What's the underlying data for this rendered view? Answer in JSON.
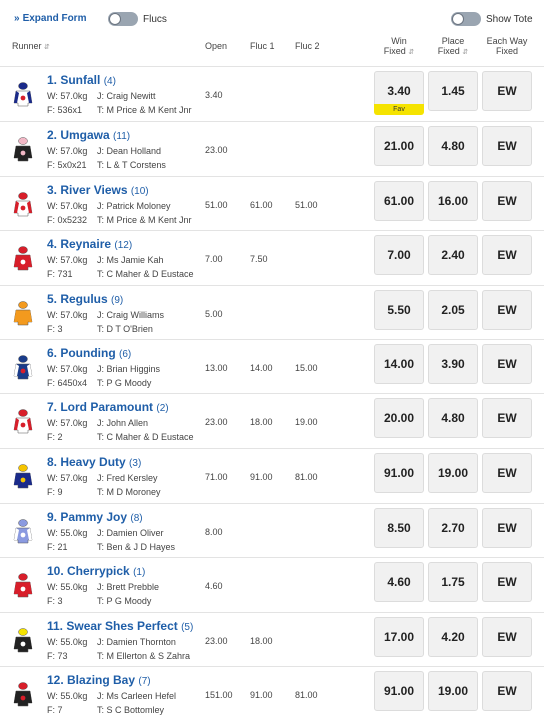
{
  "toolbar": {
    "expand_label": "Expand Form",
    "flucs_label": "Flucs",
    "show_tote_label": "Show Tote"
  },
  "columns": {
    "runner": "Runner",
    "open": "Open",
    "fluc1": "Fluc 1",
    "fluc2": "Fluc 2",
    "win_fixed_1": "Win",
    "win_fixed_2": "Fixed",
    "place_fixed_1": "Place",
    "place_fixed_2": "Fixed",
    "ew_1": "Each Way",
    "ew_2": "Fixed"
  },
  "fav_label": "Fav",
  "runners": [
    {
      "name": "1. Sunfall",
      "barrier": "(4)",
      "weight": "W: 57.0kg",
      "jockey": "J: Craig Newitt",
      "form": "F: 536x1",
      "trainer": "T: M Price & M Kent Jnr",
      "open": "3.40",
      "fluc1": "",
      "fluc2": "",
      "win": "3.40",
      "place": "1.45",
      "ew": "EW",
      "silk": {
        "body": "#ffffff",
        "sleeve": "#1a2a8a",
        "cap": "#1a2a8a",
        "accent": "#d81e2a"
      }
    },
    {
      "name": "2. Umgawa",
      "barrier": "(11)",
      "weight": "W: 57.0kg",
      "jockey": "J: Dean Holland",
      "form": "F: 5x0x21",
      "trainer": "T: L & T Corstens",
      "open": "23.00",
      "fluc1": "",
      "fluc2": "",
      "win": "21.00",
      "place": "4.80",
      "ew": "EW",
      "silk": {
        "body": "#222222",
        "sleeve": "#222222",
        "cap": "#f2b8c6",
        "accent": "#f2b8c6"
      }
    },
    {
      "name": "3. River Views",
      "barrier": "(10)",
      "weight": "W: 57.0kg",
      "jockey": "J: Patrick Moloney",
      "form": "F: 0x5232",
      "trainer": "T: M Price & M Kent Jnr",
      "open": "51.00",
      "fluc1": "61.00",
      "fluc2": "51.00",
      "win": "61.00",
      "place": "16.00",
      "ew": "EW",
      "silk": {
        "body": "#ffffff",
        "sleeve": "#d81e2a",
        "cap": "#d81e2a",
        "accent": "#d81e2a"
      }
    },
    {
      "name": "4. Reynaire",
      "barrier": "(12)",
      "weight": "W: 57.0kg",
      "jockey": "J: Ms Jamie Kah",
      "form": "F: 731",
      "trainer": "T: C Maher & D Eustace",
      "open": "7.00",
      "fluc1": "7.50",
      "fluc2": "",
      "win": "7.00",
      "place": "2.40",
      "ew": "EW",
      "silk": {
        "body": "#d81e2a",
        "sleeve": "#d81e2a",
        "cap": "#d81e2a",
        "accent": "#ffffff"
      }
    },
    {
      "name": "5. Regulus",
      "barrier": "(9)",
      "weight": "W: 57.0kg",
      "jockey": "J: Craig Williams",
      "form": "F: 3",
      "trainer": "T: D T O'Brien",
      "open": "5.00",
      "fluc1": "",
      "fluc2": "",
      "win": "5.50",
      "place": "2.05",
      "ew": "EW",
      "silk": {
        "body": "#f39a1e",
        "sleeve": "#f39a1e",
        "cap": "#f39a1e",
        "accent": "#f39a1e"
      }
    },
    {
      "name": "6. Pounding",
      "barrier": "(6)",
      "weight": "W: 57.0kg",
      "jockey": "J: Brian Higgins",
      "form": "F: 6450x4",
      "trainer": "T: P G Moody",
      "open": "13.00",
      "fluc1": "14.00",
      "fluc2": "15.00",
      "win": "14.00",
      "place": "3.90",
      "ew": "EW",
      "silk": {
        "body": "#1a3c8a",
        "sleeve": "#ffffff",
        "cap": "#1a3c8a",
        "accent": "#d81e2a"
      }
    },
    {
      "name": "7. Lord Paramount",
      "barrier": "(2)",
      "weight": "W: 57.0kg",
      "jockey": "J: John Allen",
      "form": "F: 2",
      "trainer": "T: C Maher & D Eustace",
      "open": "23.00",
      "fluc1": "18.00",
      "fluc2": "19.00",
      "win": "20.00",
      "place": "4.80",
      "ew": "EW",
      "silk": {
        "body": "#ffffff",
        "sleeve": "#d81e2a",
        "cap": "#d81e2a",
        "accent": "#d81e2a"
      }
    },
    {
      "name": "8. Heavy Duty",
      "barrier": "(3)",
      "weight": "W: 57.0kg",
      "jockey": "J: Fred Kersley",
      "form": "F: 9",
      "trainer": "T: M D Moroney",
      "open": "71.00",
      "fluc1": "91.00",
      "fluc2": "81.00",
      "win": "91.00",
      "place": "19.00",
      "ew": "EW",
      "silk": {
        "body": "#1a2a8a",
        "sleeve": "#1a2a8a",
        "cap": "#f5c400",
        "accent": "#f5c400"
      }
    },
    {
      "name": "9. Pammy Joy",
      "barrier": "(8)",
      "weight": "W: 55.0kg",
      "jockey": "J: Damien Oliver",
      "form": "F: 21",
      "trainer": "T: Ben & J D Hayes",
      "open": "8.00",
      "fluc1": "",
      "fluc2": "",
      "win": "8.50",
      "place": "2.70",
      "ew": "EW",
      "silk": {
        "body": "#8a9ae0",
        "sleeve": "#ffffff",
        "cap": "#8a9ae0",
        "accent": "#ffffff"
      }
    },
    {
      "name": "10. Cherrypick",
      "barrier": "(1)",
      "weight": "W: 55.0kg",
      "jockey": "J: Brett Prebble",
      "form": "F: 3",
      "trainer": "T: P G Moody",
      "open": "4.60",
      "fluc1": "",
      "fluc2": "",
      "win": "4.60",
      "place": "1.75",
      "ew": "EW",
      "silk": {
        "body": "#d81e2a",
        "sleeve": "#d81e2a",
        "cap": "#d81e2a",
        "accent": "#ffffff"
      }
    },
    {
      "name": "11. Swear Shes Perfect",
      "barrier": "(5)",
      "weight": "W: 55.0kg",
      "jockey": "J: Damien Thornton",
      "form": "F: 73",
      "trainer": "T: M Ellerton & S Zahra",
      "open": "23.00",
      "fluc1": "18.00",
      "fluc2": "",
      "win": "17.00",
      "place": "4.20",
      "ew": "EW",
      "silk": {
        "body": "#222222",
        "sleeve": "#222222",
        "cap": "#f5e300",
        "accent": "#ffffff"
      }
    },
    {
      "name": "12. Blazing Bay",
      "barrier": "(7)",
      "weight": "W: 55.0kg",
      "jockey": "J: Ms Carleen Hefel",
      "form": "F: 7",
      "trainer": "T: S C Bottomley",
      "open": "151.00",
      "fluc1": "91.00",
      "fluc2": "81.00",
      "win": "91.00",
      "place": "19.00",
      "ew": "EW",
      "silk": {
        "body": "#222222",
        "sleeve": "#222222",
        "cap": "#d81e2a",
        "accent": "#d81e2a"
      }
    }
  ]
}
